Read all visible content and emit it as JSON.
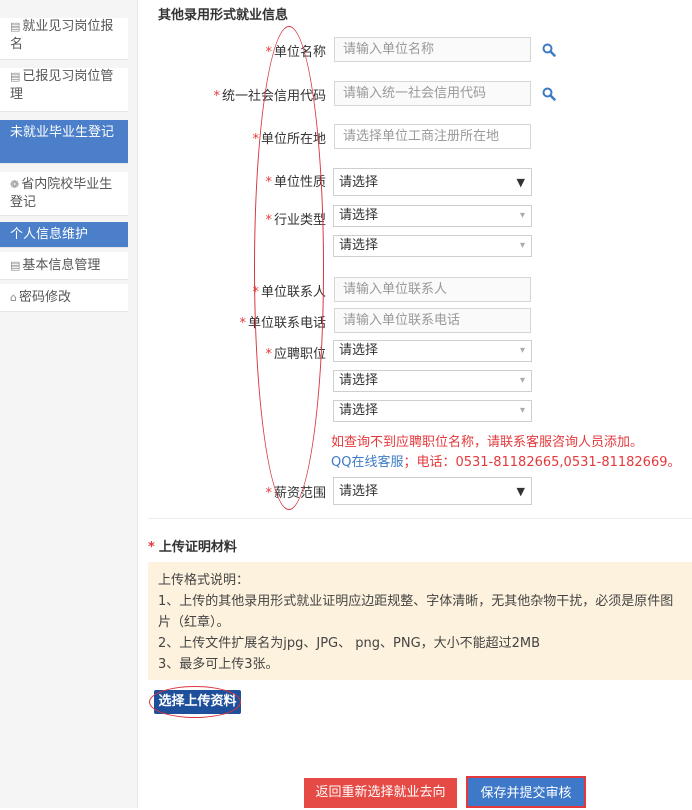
{
  "sidebar": {
    "items": [
      {
        "icon": "▤",
        "label": "就业见习岗位报名"
      },
      {
        "icon": "▤",
        "label": "已报见习岗位管理"
      },
      {
        "icon": "",
        "label": "未就业毕业生登记"
      },
      {
        "icon": "❁",
        "label": "省内院校毕业生登记"
      },
      {
        "icon": "",
        "label": "个人信息维护"
      },
      {
        "icon": "▤",
        "label": "基本信息管理"
      },
      {
        "icon": "⌂",
        "label": "密码修改"
      }
    ]
  },
  "form": {
    "section_title": "其他录用形式就业信息",
    "required_mark": "*",
    "unit_name": {
      "label": "单位名称",
      "placeholder": "请输入单位名称"
    },
    "credit_code": {
      "label": "统一社会信用代码",
      "placeholder": "请输入统一社会信用代码"
    },
    "location": {
      "label": "单位所在地",
      "placeholder": "请选择单位工商注册所在地"
    },
    "nature": {
      "label": "单位性质",
      "value": "请选择"
    },
    "industry": {
      "label": "行业类型",
      "value1": "请选择",
      "value2": "请选择"
    },
    "contact": {
      "label": "单位联系人",
      "placeholder": "请输入单位联系人"
    },
    "phone": {
      "label": "单位联系电话",
      "placeholder": "请输入单位联系电话"
    },
    "position": {
      "label": "应聘职位",
      "value1": "请选择",
      "value2": "请选择",
      "value3": "请选择"
    },
    "notice_red": "如查询不到应聘职位名称，请联系客服咨询人员添加。",
    "qq_link": "QQ在线客服",
    "qq_rest": "；电话：0531-81182665,0531-81182669。",
    "salary": {
      "label": "薪资范围",
      "value": "请选择"
    }
  },
  "upload": {
    "title": "上传证明材料",
    "notice_lines": [
      "上传格式说明：",
      "1、上传的其他录用形式就业证明应边距规整、字体清晰，无其他杂物干扰，必须是原件图片（红章）。",
      "2、上传文件扩展名为jpg、JPG、 png、PNG，大小不能超过2MB",
      "3、最多可上传3张。"
    ],
    "button": "选择上传资料"
  },
  "actions": {
    "back": "返回重新选择就业去向",
    "submit": "保存并提交审核"
  },
  "colors": {
    "accent": "#4b7fc9",
    "danger": "#e4393c",
    "upload_btn": "#1e4f9a"
  }
}
